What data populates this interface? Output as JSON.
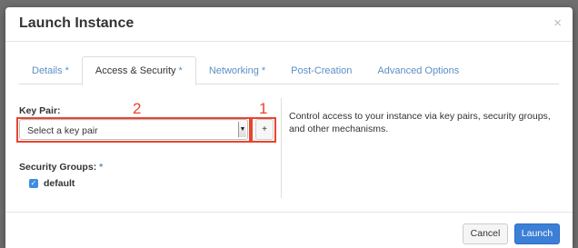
{
  "modal": {
    "title": "Launch Instance",
    "close_glyph": "×"
  },
  "tabs": [
    {
      "label": "Details",
      "required": "*",
      "active": false
    },
    {
      "label": "Access & Security",
      "required": "*",
      "active": true
    },
    {
      "label": "Networking",
      "required": "*",
      "active": false
    },
    {
      "label": "Post-Creation",
      "required": "",
      "active": false
    },
    {
      "label": "Advanced Options",
      "required": "",
      "active": false
    }
  ],
  "key_pair": {
    "label": "Key Pair:",
    "selected_value": "Select a key pair",
    "add_button_label": "+"
  },
  "security_groups": {
    "label": "Security Groups:",
    "required": "*",
    "options": [
      {
        "label": "default",
        "checked": true
      }
    ]
  },
  "help_text": "Control access to your instance via key pairs, security groups, and other mechanisms.",
  "annotations": {
    "add_button_number": "1",
    "select_number": "2"
  },
  "footer": {
    "cancel_label": "Cancel",
    "launch_label": "Launch"
  },
  "colors": {
    "accent": "#3c7fd7",
    "annotation": "#e8442e",
    "tab_link": "#5b8fc7"
  }
}
